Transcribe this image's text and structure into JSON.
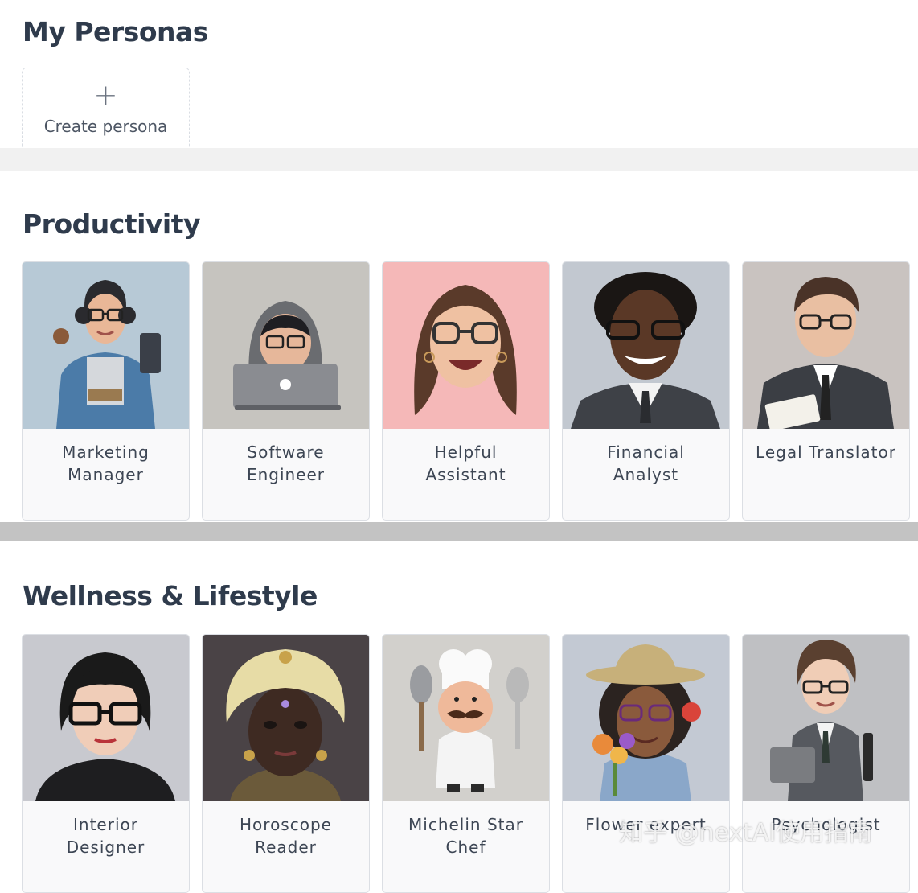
{
  "my_personas": {
    "title": "My Personas",
    "create": {
      "icon": "plus-icon",
      "glyph": "+",
      "label": "Create persona"
    }
  },
  "productivity": {
    "title": "Productivity",
    "personas": [
      {
        "label": "Marketing\nManager",
        "bg": "#b7c9d6"
      },
      {
        "label": "Software\nEngineer",
        "bg": "#c6c4bf"
      },
      {
        "label": "Helpful\nAssistant",
        "bg": "#f5b8b8"
      },
      {
        "label": "Financial\nAnalyst",
        "bg": "#c2c8d0"
      },
      {
        "label": "Legal Translator",
        "bg": "#c9c3c0"
      }
    ]
  },
  "wellness": {
    "title": "Wellness & Lifestyle",
    "personas": [
      {
        "label": "Interior\nDesigner",
        "bg": "#c8c9cf"
      },
      {
        "label": "Horoscope\nReader",
        "bg": "#4a4346"
      },
      {
        "label": "Michelin Star\nChef",
        "bg": "#d2d0cc"
      },
      {
        "label": "Flower expert",
        "bg": "#c3c9d3"
      },
      {
        "label": "Psychologist",
        "bg": "#bfc0c3"
      }
    ]
  },
  "watermark": "知乎 @nextAI使用指南",
  "colors": {
    "heading": "#2f3b4c",
    "divider_light": "#f1f1f1",
    "divider_dark": "#c3c3c3",
    "card_bg": "#f9f9fa",
    "card_border": "#dcdfe4"
  }
}
